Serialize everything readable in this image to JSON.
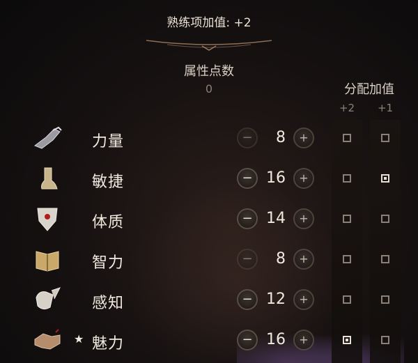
{
  "header": {
    "bonus_label": "熟练项加值: +2"
  },
  "columns": {
    "points_title": "属性点数",
    "points_remaining": "0",
    "alloc_title": "分配加值",
    "alloc_plus2": "+2",
    "alloc_plus1": "+1"
  },
  "controls": {
    "minus_symbol": "−",
    "plus_symbol": "+"
  },
  "attributes": [
    {
      "name": "力量",
      "value": "8",
      "icon": "gauntlet-icon",
      "star": "",
      "plus2": false,
      "plus1": false
    },
    {
      "name": "敏捷",
      "value": "16",
      "icon": "boot-icon",
      "star": "",
      "plus2": false,
      "plus1": true
    },
    {
      "name": "体质",
      "value": "14",
      "icon": "shield-heart-icon",
      "star": "",
      "plus2": false,
      "plus1": false
    },
    {
      "name": "智力",
      "value": "8",
      "icon": "scroll-book-icon",
      "star": "",
      "plus2": false,
      "plus1": false
    },
    {
      "name": "感知",
      "value": "12",
      "icon": "hand-feather-icon",
      "star": "",
      "plus2": false,
      "plus1": false
    },
    {
      "name": "魅力",
      "value": "16",
      "icon": "handshake-icon",
      "star": "★",
      "plus2": true,
      "plus1": false
    }
  ]
}
